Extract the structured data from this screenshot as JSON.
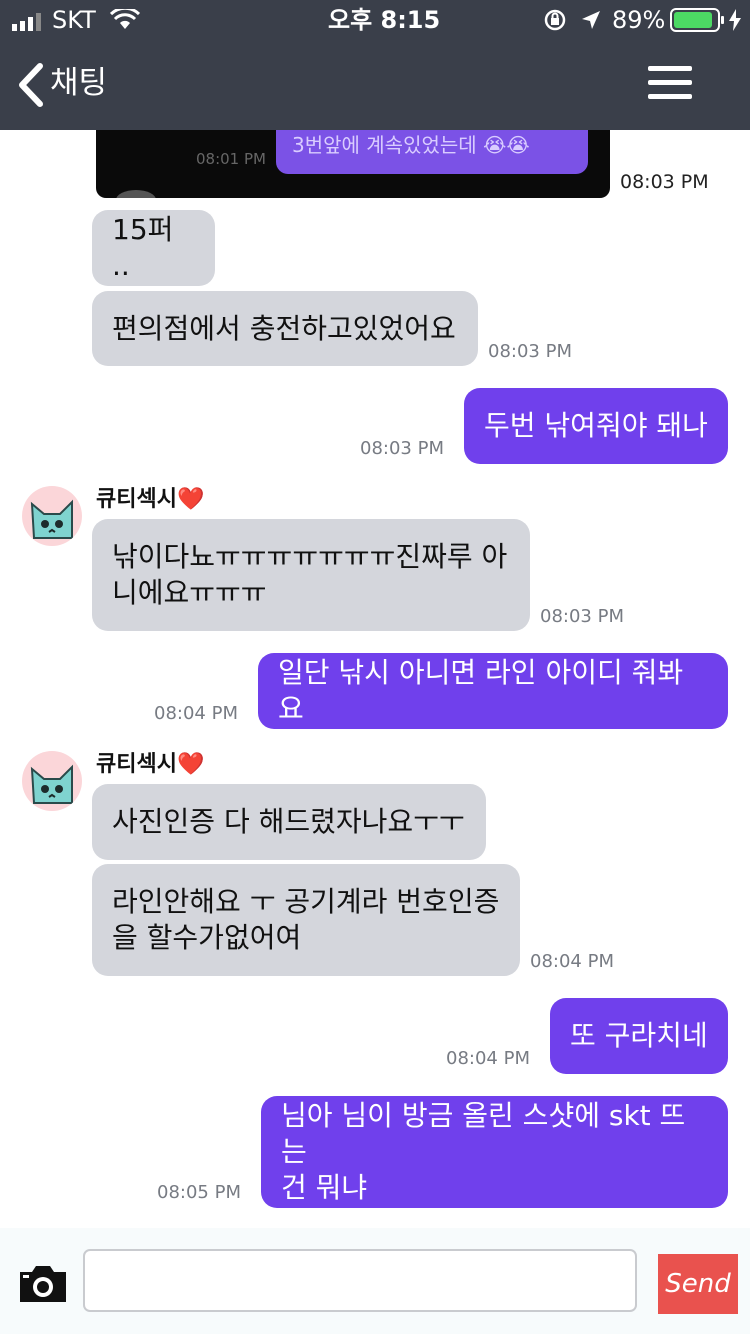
{
  "status_bar": {
    "carrier": "SKT",
    "time": "오후 8:15",
    "battery": "89%"
  },
  "nav": {
    "title": "채팅"
  },
  "shared_screenshot": {
    "time": "08:01 PM",
    "text": "3번앞에 계속있었는데 😭😭",
    "timestamp": "08:03 PM"
  },
  "messages": [
    {
      "side": "in",
      "text": "15퍼 .."
    },
    {
      "side": "in",
      "text": "편의점에서 충전하고있었어요",
      "timestamp": "08:03 PM"
    },
    {
      "side": "out",
      "text": "두번 낚여줘야 돼나",
      "timestamp": "08:03 PM"
    },
    {
      "side": "in",
      "sender": "큐티섹시",
      "heart": "❤️",
      "text_line1": "낚이다뇨ㅠㅠㅠㅠㅠㅠㅠ진짜루 아",
      "text_line2": "니에요ㅠㅠㅠ",
      "timestamp": "08:03 PM"
    },
    {
      "side": "out",
      "text": "일단 낚시 아니면 라인 아이디 줘봐요",
      "timestamp": "08:04 PM"
    },
    {
      "side": "in",
      "sender": "큐티섹시",
      "heart": "❤️",
      "text": "사진인증 다 해드렸자나요ㅜㅜ"
    },
    {
      "side": "in",
      "text_line1": "라인안해요 ㅜ 공기계라 번호인증",
      "text_line2": "을 할수가없어여",
      "timestamp": "08:04 PM"
    },
    {
      "side": "out",
      "text": "또 구라치네",
      "timestamp": "08:04 PM"
    },
    {
      "side": "out",
      "text_line1": "님아 님이 방금 올린 스샷에 skt 뜨는",
      "text_line2": "건 뭐냐",
      "timestamp": "08:05 PM"
    }
  ],
  "composer": {
    "placeholder": "",
    "send_label": "Send"
  },
  "colors": {
    "header_bg": "#3a3f4a",
    "outgoing_bubble": "#7040ec",
    "incoming_bubble": "#d4d6dc",
    "send_button": "#e9524e",
    "battery_green": "#4cd964"
  }
}
